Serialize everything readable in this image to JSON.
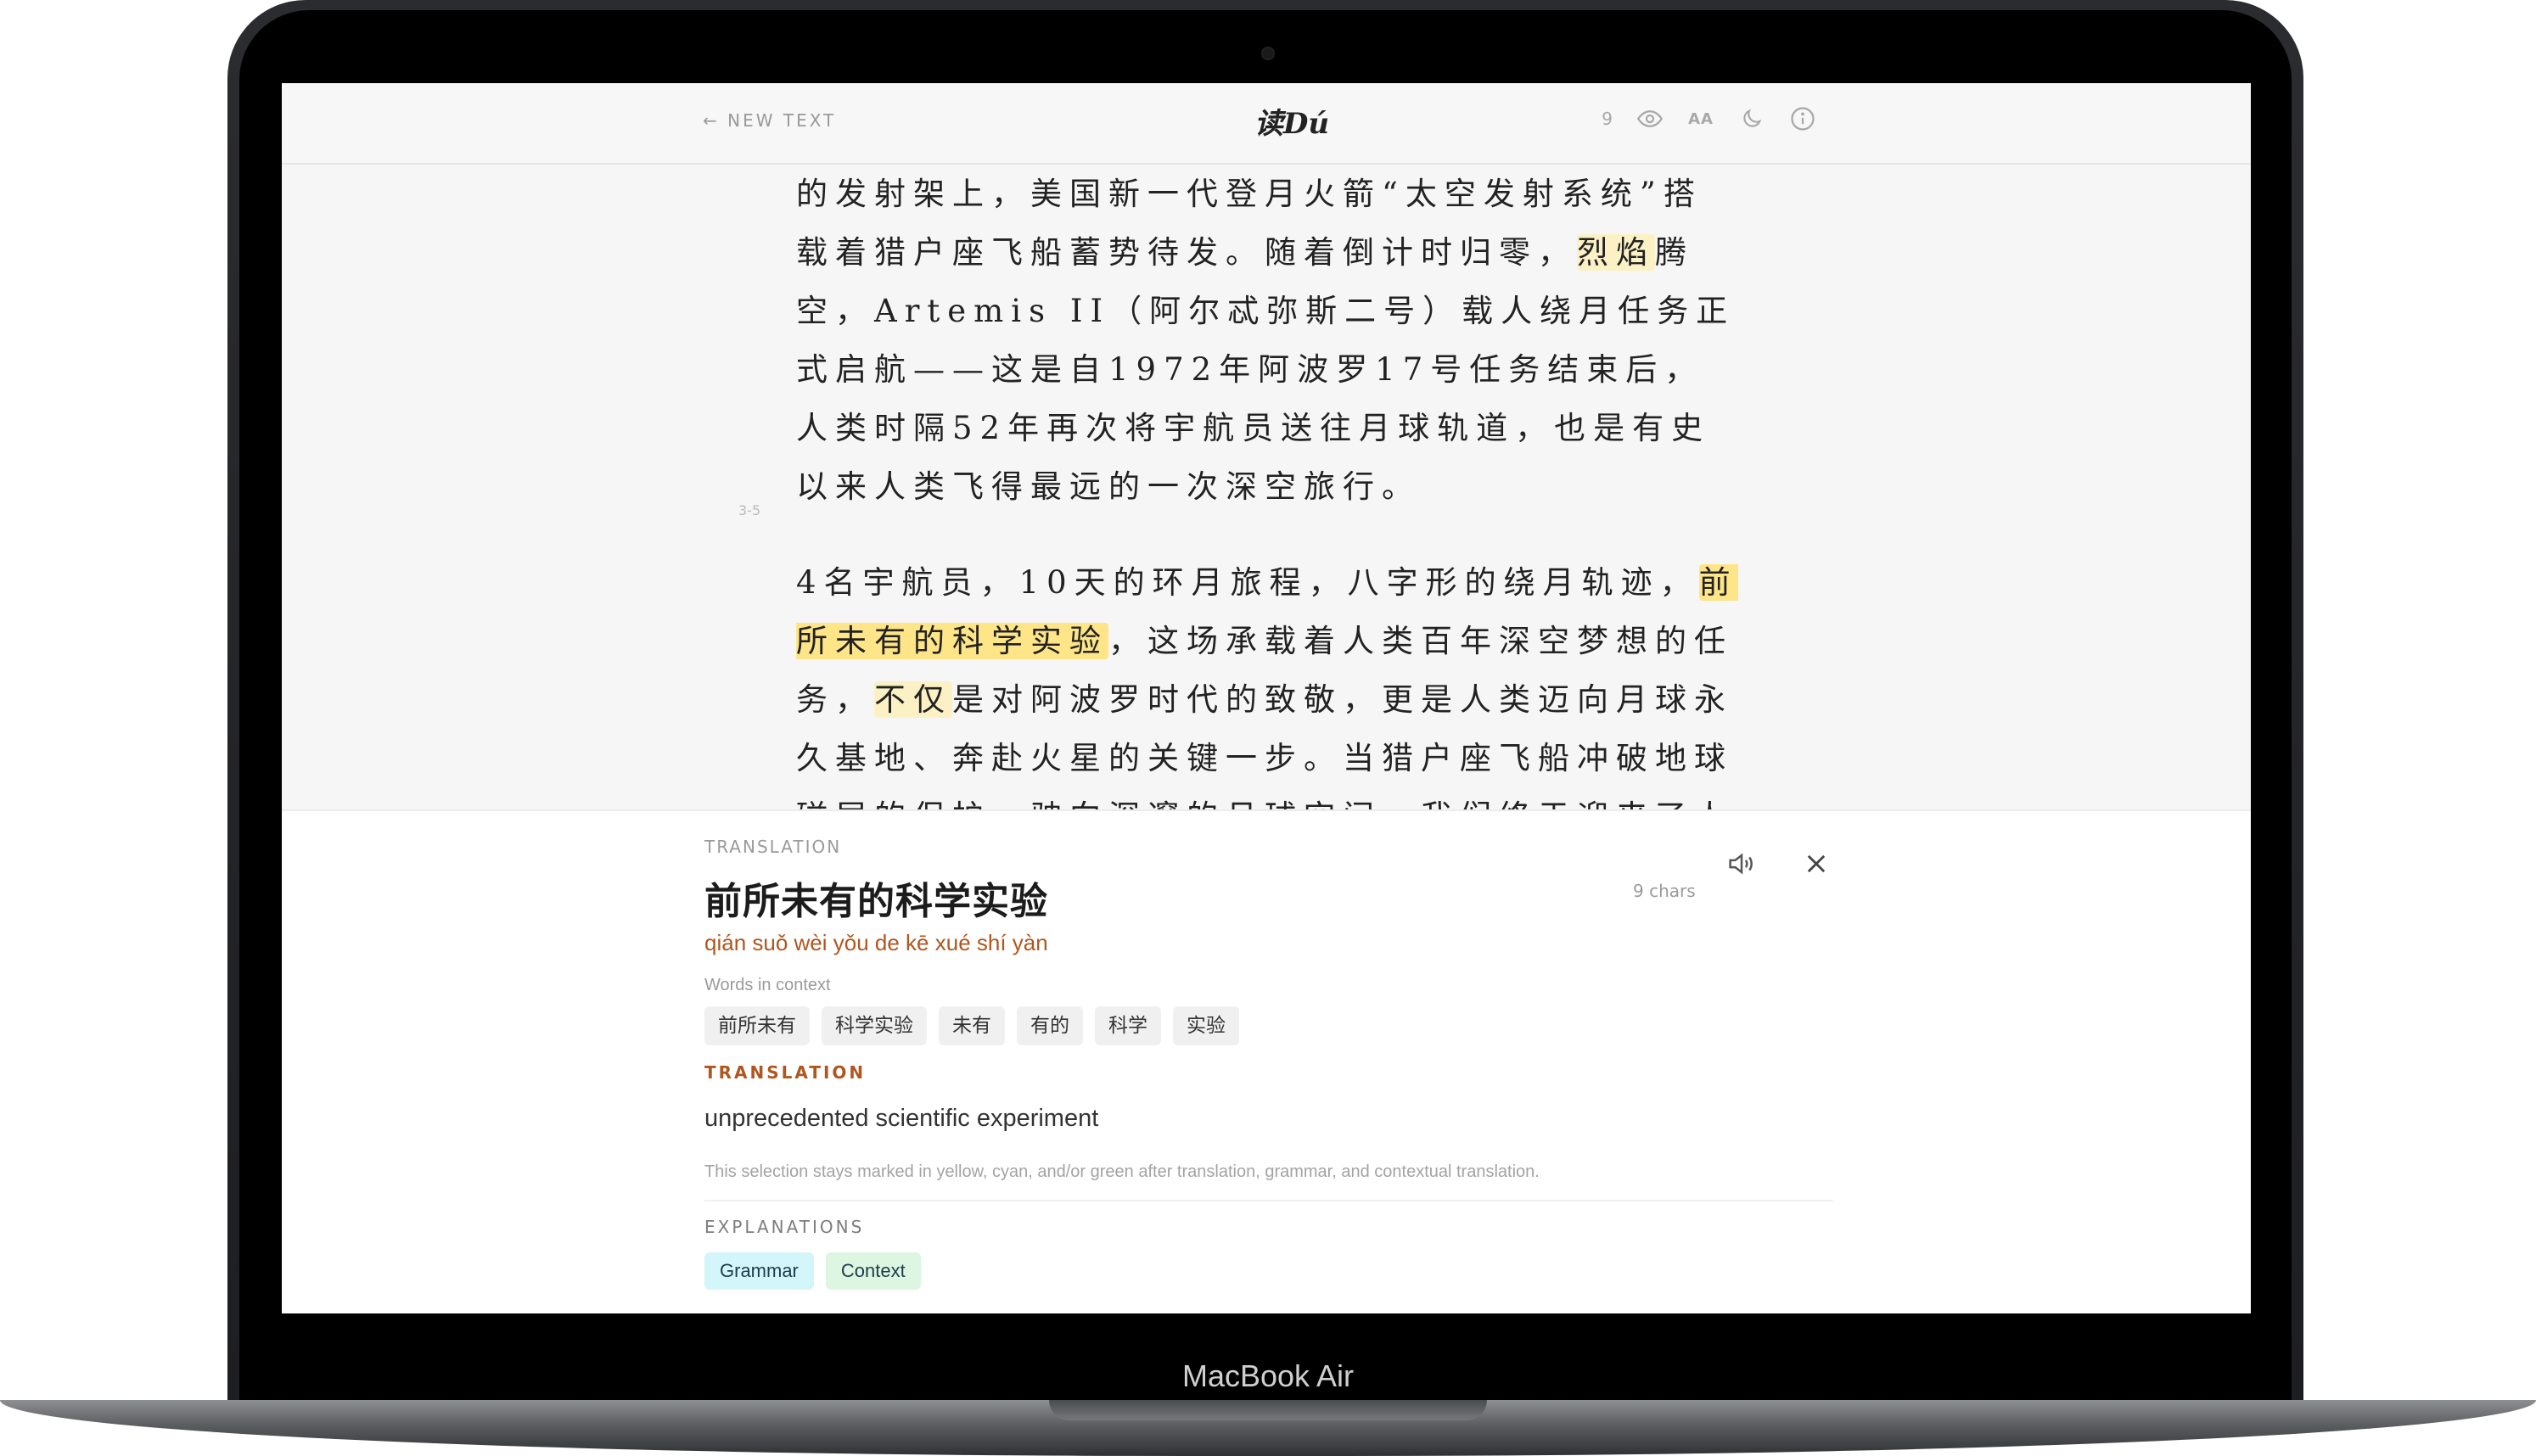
{
  "device": {
    "label": "MacBook Air"
  },
  "header": {
    "back_label": "← NEW TEXT",
    "brand": "读Dú",
    "count": "9",
    "font_size_label": "AA",
    "icons": [
      "eye-icon",
      "moon-icon",
      "info-icon"
    ]
  },
  "reader": {
    "paragraphs": [
      {
        "segments": [
          {
            "text": "的发射架上，美国新一代登月火箭“太空发射系统”搭载着猎户座飞船蓄势待发。随着倒计时归零，",
            "mark": "none"
          },
          {
            "text": "烈焰",
            "mark": "light-yellow"
          },
          {
            "text": "腾空，Artemis II（阿尔忒弥斯二号）载人绕月任务正式启航——这是自1972年阿波罗17号任务结束后，人类时隔52年再次将宇航员送往月球轨道，也是有史以来人类飞得最远的一次深空旅行。",
            "mark": "none"
          }
        ]
      },
      {
        "number": "3-5",
        "segments": [
          {
            "text": "4名宇航员，10天的环月旅程，八字形的绕月轨迹，",
            "mark": "none"
          },
          {
            "text": "前所未有的科学实验",
            "mark": "yellow"
          },
          {
            "text": "，这场承载着人类百年深空梦想的任务，",
            "mark": "none"
          },
          {
            "text": "不仅",
            "mark": "light-yellow"
          },
          {
            "text": "是对阿波罗时代的致敬，更是人类迈向月球永久基地、奔赴火星的关键一步。当猎户座飞船冲破地球磁层的保护，驶向深邃的月球空间，我们终于迎来了人类深空探索的全新纪元。这一次，我们不再只是“触摸”月球，而是要在月球扎根，让人类成为真正的星际物",
            "mark": "none"
          }
        ]
      }
    ]
  },
  "panel": {
    "label": "TRANSLATION",
    "word": "前所未有的科学实验",
    "pinyin": "qián suǒ wèi yǒu de kē xué shí yàn",
    "chars": "9 chars",
    "words_in_context_label": "Words in context",
    "words_in_context": [
      "前所未有",
      "科学实验",
      "未有",
      "有的",
      "科学",
      "实验"
    ],
    "translation_label": "TRANSLATION",
    "translation": "unprecedented scientific experiment",
    "note": "This selection stays marked in yellow, cyan, and/or green after translation, grammar, and contextual translation.",
    "explanations_label": "EXPLANATIONS",
    "explanations": [
      {
        "label": "Grammar",
        "color": "#d3f6fa"
      },
      {
        "label": "Context",
        "color": "#dcf6e1"
      }
    ]
  },
  "colors": {
    "highlight_yellow": "#fde588",
    "highlight_light_yellow": "#fbf1c4",
    "pinyin_accent": "#b0561f",
    "grammar_cyan": "#d3f6fa",
    "context_green": "#dcf6e1"
  }
}
